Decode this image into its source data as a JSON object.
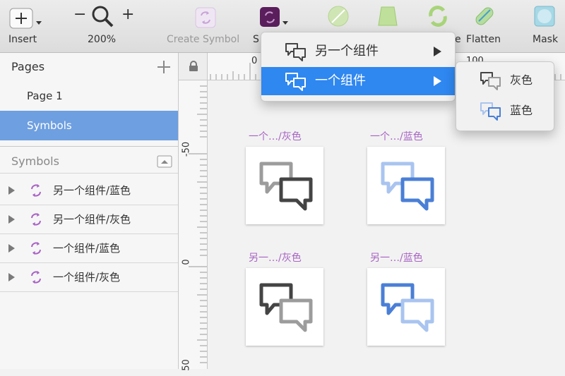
{
  "toolbar": {
    "insert_label": "Insert",
    "zoom_label": "200%",
    "zoom_minus": "−",
    "zoom_plus": "+",
    "create_symbol_label": "Create Symbol",
    "symbol_cut_label": "S",
    "hidden_e": "e",
    "flatten_label": "Flatten",
    "mask_label": "Mask"
  },
  "sidebar": {
    "pages_header": "Pages",
    "pages": [
      {
        "label": "Page 1",
        "selected": false
      },
      {
        "label": "Symbols",
        "selected": true
      }
    ],
    "symbols_header": "Symbols",
    "symbols": [
      {
        "label": "另一个组件/蓝色"
      },
      {
        "label": "另一个组件/灰色"
      },
      {
        "label": "一个组件/蓝色"
      },
      {
        "label": "一个组件/灰色"
      }
    ]
  },
  "rulers": {
    "top_labels": [
      "0",
      "100"
    ],
    "left_labels": [
      "-50",
      "0",
      "50"
    ]
  },
  "canvas": {
    "artboards": [
      {
        "label": "一个…/灰色"
      },
      {
        "label": "一个…/蓝色"
      },
      {
        "label": "另一…/灰色"
      },
      {
        "label": "另一…/蓝色"
      }
    ]
  },
  "menu": {
    "items": [
      {
        "label": "另一个组件"
      },
      {
        "label": "一个组件"
      }
    ],
    "submenu": [
      {
        "label": "灰色"
      },
      {
        "label": "蓝色"
      }
    ]
  },
  "colors": {
    "accent": "#2f87f0",
    "selection": "#6e9fe0",
    "symbol_purple": "#a863c4",
    "gray_icon": "#999999",
    "dark_icon": "#444444",
    "blue_light": "#a9c4ef",
    "blue_dark": "#4a7fd6"
  }
}
